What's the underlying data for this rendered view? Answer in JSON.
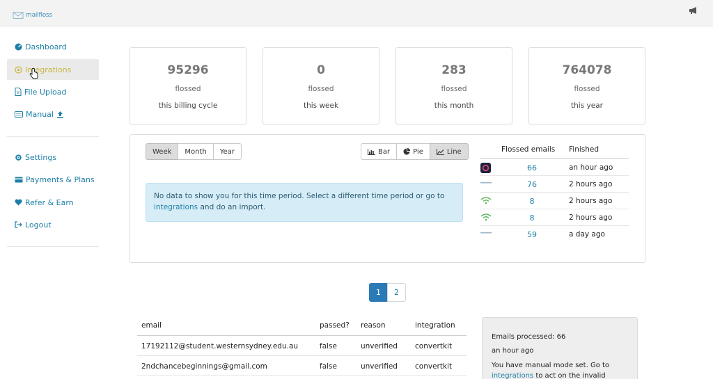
{
  "app": {
    "logo_text": "mailfloss"
  },
  "sidebar": {
    "items": [
      {
        "label": "Dashboard",
        "icon": "dashboard-icon",
        "active": false
      },
      {
        "label": "Integrations",
        "icon": "integrations-icon",
        "active": true
      },
      {
        "label": "File Upload",
        "icon": "file-icon",
        "active": false
      },
      {
        "label": "Manual",
        "icon": "upload-icon",
        "active": false
      }
    ],
    "secondary_items": [
      {
        "label": "Settings",
        "icon": "gear-icon"
      },
      {
        "label": "Payments & Plans",
        "icon": "credit-card-icon"
      },
      {
        "label": "Refer & Earn",
        "icon": "heart-icon"
      },
      {
        "label": "Logout",
        "icon": "logout-icon"
      }
    ]
  },
  "stats": [
    {
      "value": "95296",
      "label": "flossed",
      "period": "this billing cycle"
    },
    {
      "value": "0",
      "label": "flossed",
      "period": "this week"
    },
    {
      "value": "283",
      "label": "flossed",
      "period": "this month"
    },
    {
      "value": "764078",
      "label": "flossed",
      "period": "this year"
    }
  ],
  "chart_controls": {
    "periods": [
      "Week",
      "Month",
      "Year"
    ],
    "active_period": "Week",
    "types": [
      "Bar",
      "Pie",
      "Line"
    ],
    "active_type": "Line"
  },
  "alert": {
    "text_before": "No data to show you for this time period. Select a different time period or go to",
    "link": "integrations",
    "text_after": "and do an import."
  },
  "flossed_table": {
    "headers": [
      "Flossed emails",
      "Finished"
    ],
    "rows": [
      {
        "icon": "integration-logo-icon",
        "count": "66",
        "finished": "an hour ago"
      },
      {
        "icon": "integration-logo-icon",
        "count": "76",
        "finished": "2 hours ago"
      },
      {
        "icon": "wifi-logo-icon",
        "count": "8",
        "finished": "2 hours ago"
      },
      {
        "icon": "wifi-logo-icon",
        "count": "8",
        "finished": "2 hours ago"
      },
      {
        "icon": "integration-logo-icon",
        "count": "59",
        "finished": "a day ago"
      }
    ]
  },
  "pagination": {
    "pages": [
      "1",
      "2"
    ],
    "active": "1"
  },
  "emails_table": {
    "headers": [
      "email",
      "passed?",
      "reason",
      "integration"
    ],
    "rows": [
      [
        "17192112@student.westernsydney.edu.au",
        "false",
        "unverified",
        "convertkit"
      ],
      [
        "2ndchancebeginnings@gmail.com",
        "false",
        "unverified",
        "convertkit"
      ]
    ]
  },
  "info_box": {
    "processed": "Emails processed: 66",
    "time": "an hour ago",
    "message_before": "You have manual mode set. Go to",
    "link": "integrations",
    "message_after": "to act on the invalid emails."
  },
  "colors": {
    "link": "#1e7fa6",
    "active_nav": "#c8b43e",
    "page_active": "#2b7ab8",
    "alert_bg": "#d6ecf6"
  }
}
